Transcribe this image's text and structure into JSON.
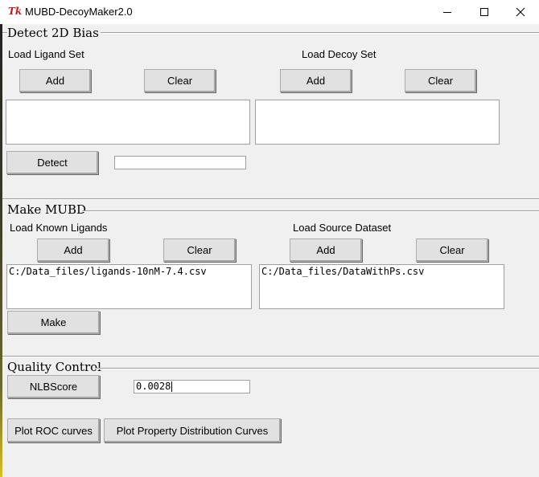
{
  "window": {
    "title": "MUBD-DecoyMaker2.0",
    "logo_text": "Tk",
    "controls": [
      "minimize-icon",
      "maximize-icon",
      "close-icon"
    ]
  },
  "detect_bias": {
    "section_title": "Detect 2D Bias",
    "ligand_label": "Load Ligand Set",
    "decoy_label": "Load Decoy Set",
    "add_label": "Add",
    "clear_label": "Clear",
    "ligand_list": [],
    "decoy_list": [],
    "detect_label": "Detect",
    "result_value": ""
  },
  "make_mubd": {
    "section_title": "Make MUBD",
    "known_label": "Load Known Ligands",
    "source_label": "Load Source Dataset",
    "add_label": "Add",
    "clear_label": "Clear",
    "known_list": [
      "C:/Data_files/ligands-10nM-7.4.csv"
    ],
    "source_list": [
      "C:/Data_files/DataWithPs.csv"
    ],
    "make_label": "Make"
  },
  "quality_control": {
    "section_title": "Quality Control",
    "nlbscore_label": "NLBScore",
    "nlbscore_value": "0.0028",
    "roc_label": "Plot ROC curves",
    "property_label": "Plot Property Distribution Curves"
  }
}
